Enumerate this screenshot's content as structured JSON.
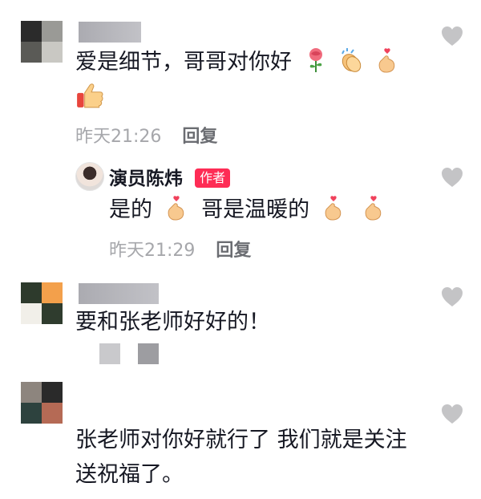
{
  "comments": [
    {
      "text": "爱是细节，哥哥对你好",
      "emojis": [
        "rose-emoji",
        "clap-emoji",
        "finger-heart-emoji"
      ],
      "emoji_line2": [
        "thumbs-up-emoji"
      ],
      "time": "昨天21:26",
      "reply_label": "回复",
      "avatar_colors": [
        "#2b2b2b",
        "#9a9a96",
        "#5a5a56",
        "#c9c8c3"
      ]
    },
    {
      "author": "演员陈炜",
      "badge": "作者",
      "text_part1": "是的",
      "text_part2": "哥是温暖的",
      "time": "昨天21:29",
      "reply_label": "回复"
    },
    {
      "text": "要和张老师好好的！",
      "avatar_colors": [
        "#2d3a2c",
        "#f3a04b",
        "#f1efe9",
        "#2f3c2e"
      ]
    },
    {
      "text_line1": "张老师对你好就行了 我们就是关注",
      "text_line2": "送祝福了。",
      "avatar_colors": [
        "#8d857e",
        "#2a2a2a",
        "#2d423e",
        "#b56a55"
      ]
    }
  ]
}
